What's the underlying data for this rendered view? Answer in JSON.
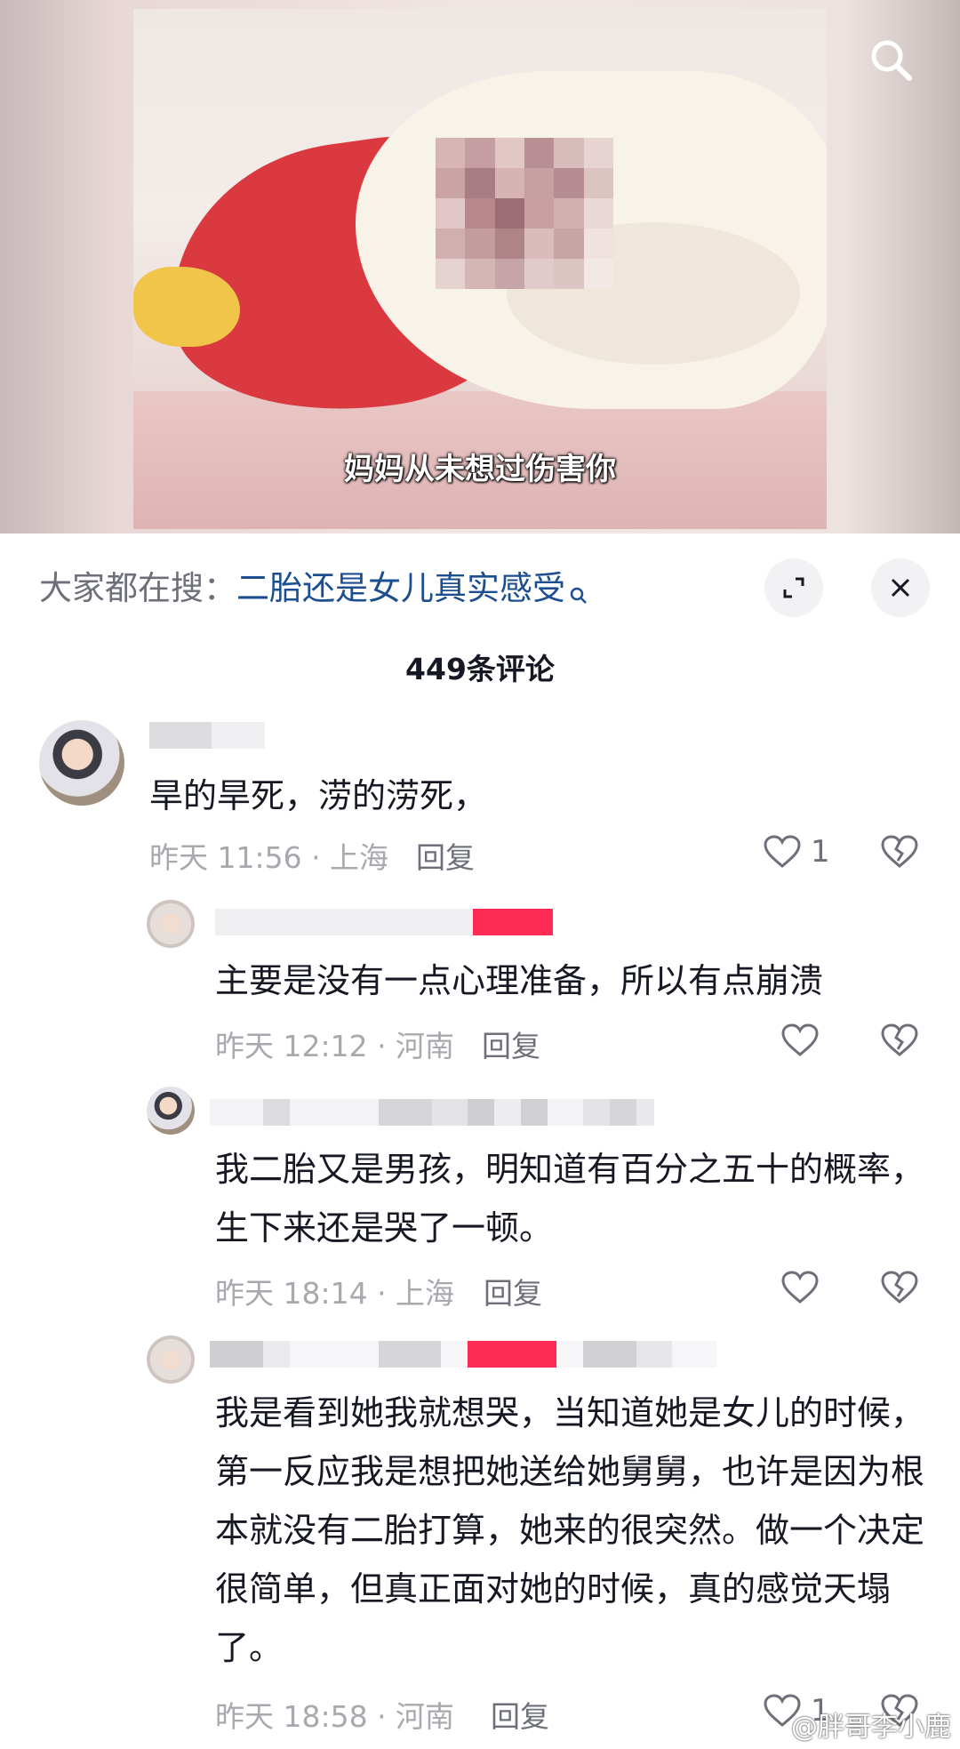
{
  "video": {
    "subtitle": "妈妈从未想过伤害你",
    "search_icon": "search-icon"
  },
  "search_bar": {
    "prefix": "大家都在搜：",
    "query": "二胎还是女儿真实感受"
  },
  "comments_header": {
    "count_text": "449条评论",
    "expand_icon": "expand-icon",
    "close_icon": "close-icon"
  },
  "comments": [
    {
      "text": "旱的旱死，涝的涝死，",
      "time_location": "昨天 11:56 · 上海",
      "reply_label": "回复",
      "likes": "1",
      "replies": [
        {
          "text": "主要是没有一点心理准备，所以有点崩溃",
          "time_location": "昨天 12:12 · 河南",
          "reply_label": "回复"
        },
        {
          "text": "我二胎又是男孩，明知道有百分之五十的概率，生下来还是哭了一顿。",
          "time_location": "昨天 18:14 · 上海",
          "reply_label": "回复"
        },
        {
          "text": "我是看到她我就想哭，当知道她是女儿的时候，第一反应我是想把她送给她舅舅，也许是因为根本就没有二胎打算，她来的很突然。做一个决定很简单，但真正面对她的时候，真的感觉天塌了。",
          "time_location": "昨天 18:58 · 河南",
          "reply_label": "回复",
          "likes": "1"
        }
      ]
    }
  ],
  "watermark": "@胖哥李小鹿",
  "colors": {
    "accent_link": "#1d4e8f",
    "meta_gray": "#a8a9ae",
    "pink_badge": "#fe2c55"
  }
}
